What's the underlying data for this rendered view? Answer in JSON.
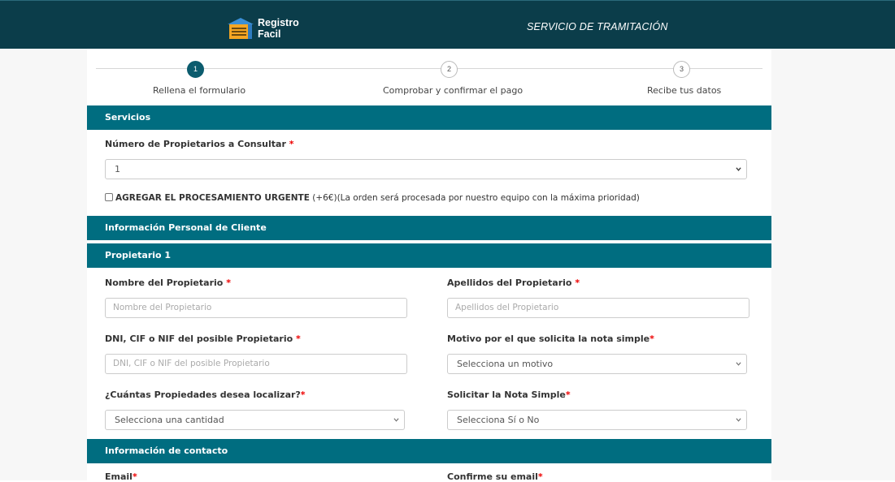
{
  "header": {
    "logo_line1": "Registro",
    "logo_line2": "Facil",
    "service_title": "SERVICIO DE TRAMITACIÓN"
  },
  "steps": [
    {
      "number": "1",
      "label": "Rellena el formulario",
      "active": true
    },
    {
      "number": "2",
      "label": "Comprobar y confirmar el pago",
      "active": false
    },
    {
      "number": "3",
      "label": "Recibe tus datos",
      "active": false
    }
  ],
  "sections": {
    "servicios": "Servicios",
    "info_personal": "Información Personal de Cliente",
    "propietario": "Propietario 1",
    "contacto": "Información de contacto"
  },
  "servicios": {
    "num_propietarios_label": "Número de Propietarios a Consultar",
    "num_propietarios_value": "1",
    "urgent_title": "AGREGAR EL PROCESAMIENTO URGENTE",
    "urgent_price": "(+6€)",
    "urgent_desc": "(La orden será procesada por nuestro equipo con la máxima prioridad)"
  },
  "propietario": {
    "nombre_label": "Nombre del Propietario",
    "nombre_placeholder": "Nombre del Propietario",
    "apellidos_label": "Apellidos del Propietario",
    "apellidos_placeholder": "Apellidos del Propietario",
    "dni_label": "DNI, CIF o NIF del posible Propietario",
    "dni_placeholder": "DNI, CIF o NIF del posible Propietario",
    "motivo_label": "Motivo por el que solicita la nota simple",
    "motivo_value": "Selecciona un motivo",
    "cantidad_label": "¿Cuántas Propiedades desea localizar?",
    "cantidad_value": "Selecciona una cantidad",
    "nota_label": "Solicitar la Nota Simple",
    "nota_value": "Selecciona Sí o No"
  },
  "contacto": {
    "email_label": "Email",
    "confirm_email_label": "Confirme su email"
  },
  "required_marker": "*",
  "colors": {
    "header_bg": "#0b3d4a",
    "section_bar": "#006d80",
    "step_active": "#0c5c6e",
    "required": "#e00000"
  }
}
